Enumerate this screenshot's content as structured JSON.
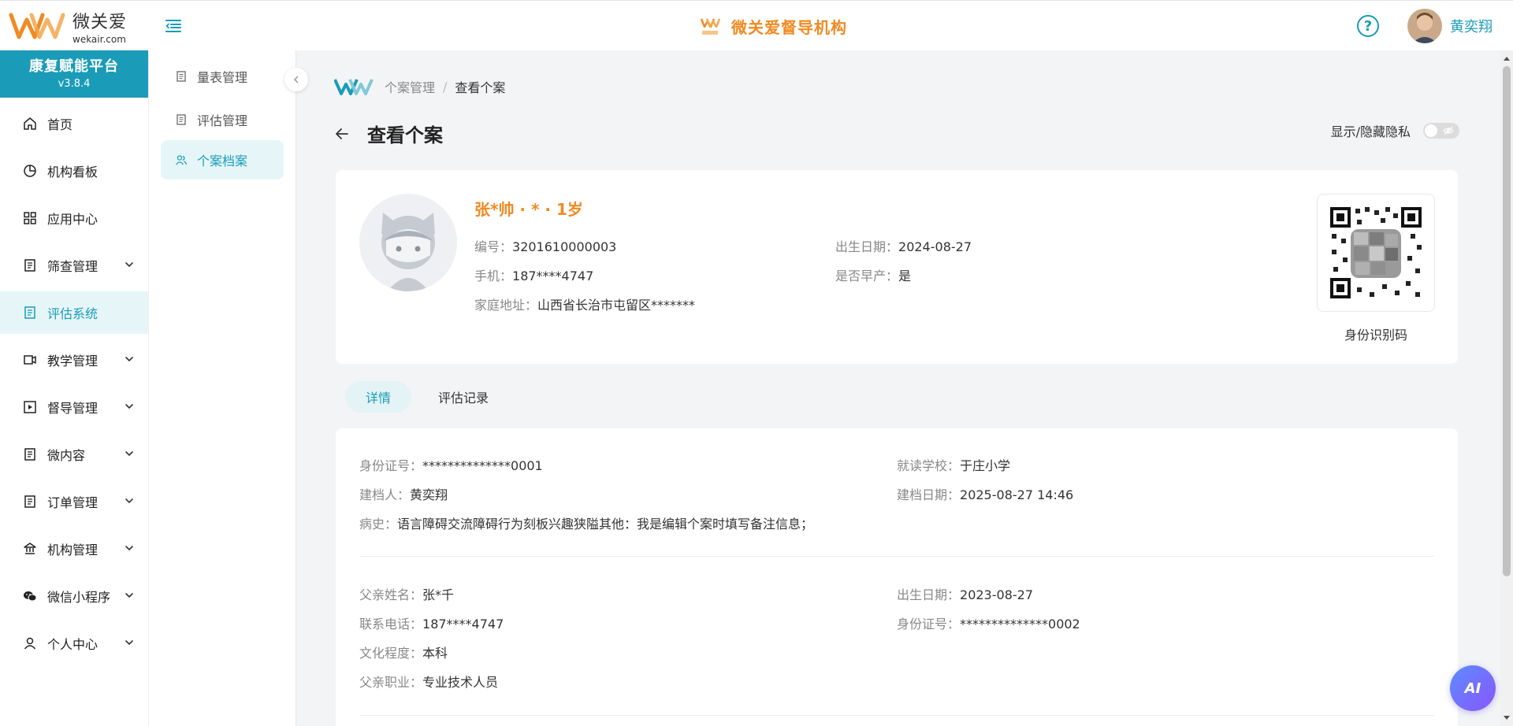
{
  "header": {
    "logo_cn": "微关爱",
    "logo_en": "wekair.com",
    "org_name": "微关爱督导机构",
    "user_name": "黄奕翔",
    "help_symbol": "?"
  },
  "sidebar": {
    "platform_name": "康复赋能平台",
    "platform_version": "v3.8.4",
    "items": [
      {
        "label": "首页",
        "icon": "home-icon"
      },
      {
        "label": "机构看板",
        "icon": "pie-chart-icon"
      },
      {
        "label": "应用中心",
        "icon": "grid-icon"
      },
      {
        "label": "筛查管理",
        "icon": "document-icon"
      },
      {
        "label": "评估系统",
        "icon": "document-icon"
      },
      {
        "label": "教学管理",
        "icon": "video-icon"
      },
      {
        "label": "督导管理",
        "icon": "play-icon"
      },
      {
        "label": "微内容",
        "icon": "document-icon"
      },
      {
        "label": "订单管理",
        "icon": "document-icon"
      },
      {
        "label": "机构管理",
        "icon": "bank-icon"
      },
      {
        "label": "微信小程序",
        "icon": "wechat-icon"
      },
      {
        "label": "个人中心",
        "icon": "user-icon"
      }
    ]
  },
  "subnav": {
    "items": [
      {
        "label": "量表管理"
      },
      {
        "label": "评估管理"
      },
      {
        "label": "个案档案"
      }
    ]
  },
  "breadcrumb": {
    "parent": "个案管理",
    "separator": "/",
    "current": "查看个案"
  },
  "page": {
    "title": "查看个案",
    "privacy_label": "显示/隐藏隐私"
  },
  "profile": {
    "name_line": "张*帅 · * · 1岁",
    "id_label": "编号：",
    "id_value": "3201610000003",
    "birth_label": "出生日期：",
    "birth_value": "2024-08-27",
    "phone_label": "手机：",
    "phone_value": "187****4747",
    "premature_label": "是否早产：",
    "premature_value": "是",
    "address_label": "家庭地址：",
    "address_value": "山西省长治市屯留区*******",
    "qr_caption": "身份识别码"
  },
  "tabs": [
    {
      "label": "详情"
    },
    {
      "label": "评估记录"
    }
  ],
  "details": {
    "idcard_label": "身份证号：",
    "idcard_value": "**************0001",
    "school_label": "就读学校：",
    "school_value": "于庄小学",
    "creator_label": "建档人：",
    "creator_value": "黄奕翔",
    "created_label": "建档日期：",
    "created_value": "2025-08-27 14:46",
    "history_label": "病史：",
    "history_value": "语言障碍交流障碍行为刻板兴趣狭隘其他：我是编辑个案时填写备注信息；",
    "father_name_label": "父亲姓名：",
    "father_name_value": "张*千",
    "father_birth_label": "出生日期：",
    "father_birth_value": "2023-08-27",
    "father_phone_label": "联系电话：",
    "father_phone_value": "187****4747",
    "father_idcard_label": "身份证号：",
    "father_idcard_value": "**************0002",
    "father_edu_label": "文化程度：",
    "father_edu_value": "本科",
    "father_job_label": "父亲职业：",
    "father_job_value": "专业技术人员"
  },
  "ai_button": {
    "label": "AI"
  },
  "colors": {
    "brand": "#1a9bb8",
    "accent": "#f08a23",
    "active_bg": "#e6f6f8"
  }
}
